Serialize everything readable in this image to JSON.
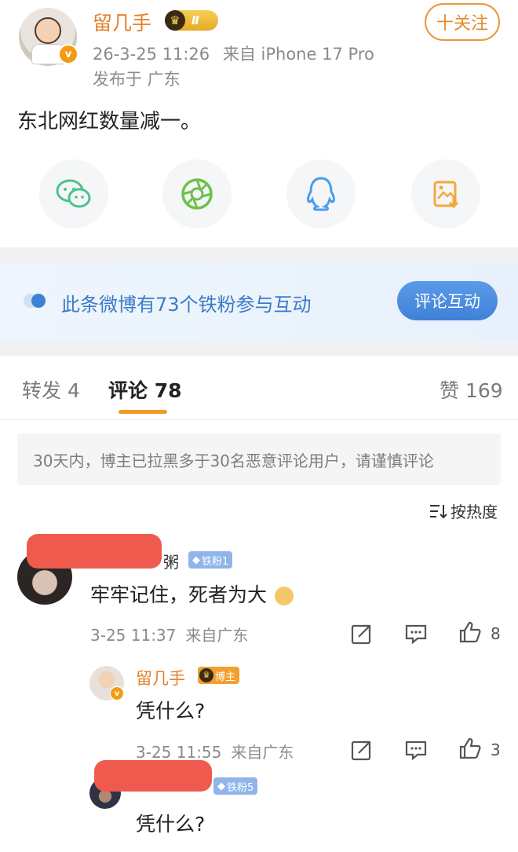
{
  "post": {
    "author": "留几手",
    "verified_mark": "v",
    "level_badge": "Ⅱ",
    "follow_label": "十关注",
    "time": "26-3-25 11:26",
    "source": "来自 iPhone 17 Pro",
    "location": "发布于 广东",
    "text": "东北网红数量减一。",
    "share_icons": [
      "wechat-icon",
      "moments-icon",
      "qq-icon",
      "save-image-icon"
    ]
  },
  "banner": {
    "text": "此条微博有73个铁粉参与互动",
    "button": "评论互动"
  },
  "tabs": {
    "repost": "转发 4",
    "comment": "评论 78",
    "like": "赞 169"
  },
  "notice": "30天内，博主已拉黑多于30名恶意评论用户，请谨慎评论",
  "sort_label": "按热度",
  "comments": [
    {
      "name_tail": "粥",
      "fan_badge": "铁粉1",
      "text": "牢牢记住，死者为大",
      "time": "3-25 11:37",
      "from": "来自广东",
      "likes": "8"
    },
    {
      "name": "留几手",
      "host_badge": "博主",
      "text": "凭什么?",
      "time": "3-25 11:55",
      "from": "来自广东",
      "likes": "3"
    },
    {
      "fan_badge": "铁粉5",
      "text": "凭什么?"
    }
  ],
  "colors": {
    "name_orange": "#e5812b",
    "accent_blue": "#3e82d8",
    "tab_underline": "#f09b2a",
    "redaction": "#ef5a4e"
  }
}
